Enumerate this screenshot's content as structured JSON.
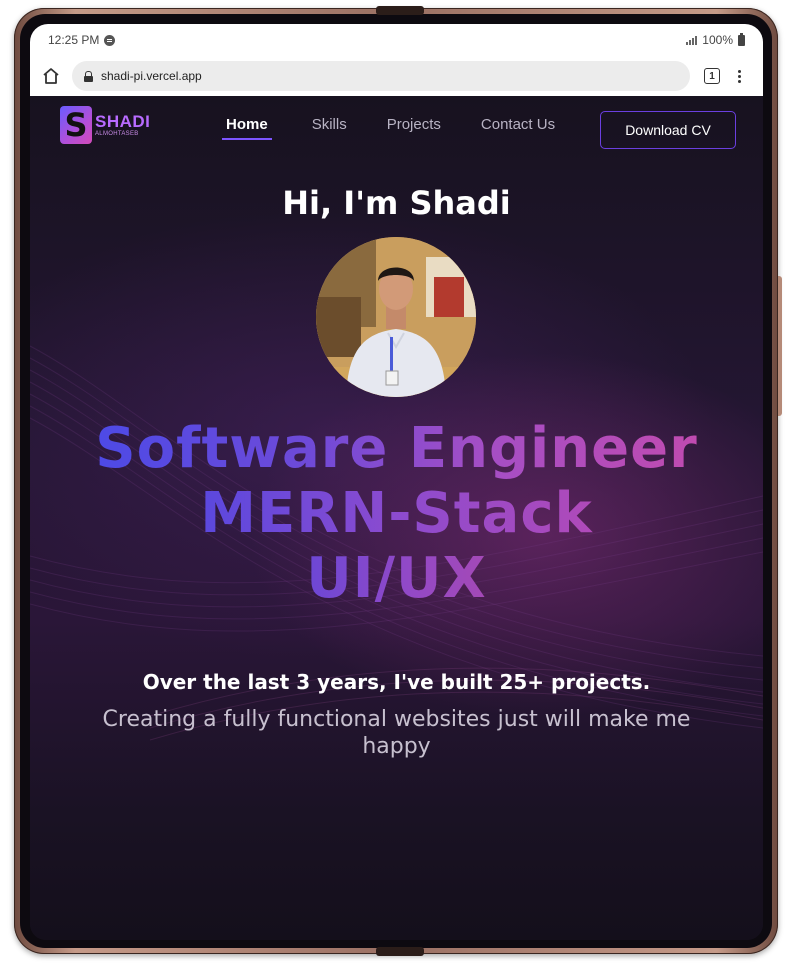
{
  "statusbar": {
    "time": "12:25 PM",
    "battery": "100%"
  },
  "browser": {
    "url": "shadi-pi.vercel.app",
    "tab_count": "1"
  },
  "site": {
    "logo": {
      "mark": "S",
      "title": "SHADI",
      "subtitle": "ALMOHTASEB"
    },
    "nav": {
      "items": [
        {
          "label": "Home",
          "active": true
        },
        {
          "label": "Skills",
          "active": false
        },
        {
          "label": "Projects",
          "active": false
        },
        {
          "label": "Contact Us",
          "active": false
        }
      ],
      "cta_label": "Download CV"
    },
    "hero": {
      "greeting": "Hi, I'm Shadi",
      "headline": [
        "Software Engineer",
        "MERN-Stack",
        "UI/UX"
      ],
      "subline": "Over the last 3 years, I've built 25+ projects.",
      "tagline": "Creating a fully functional websites just will make me happy"
    }
  },
  "colors": {
    "accent_purple": "#6b3fe0",
    "gradient_start": "#4e49e6",
    "gradient_end": "#c84aa6",
    "background": "#1a1224"
  }
}
